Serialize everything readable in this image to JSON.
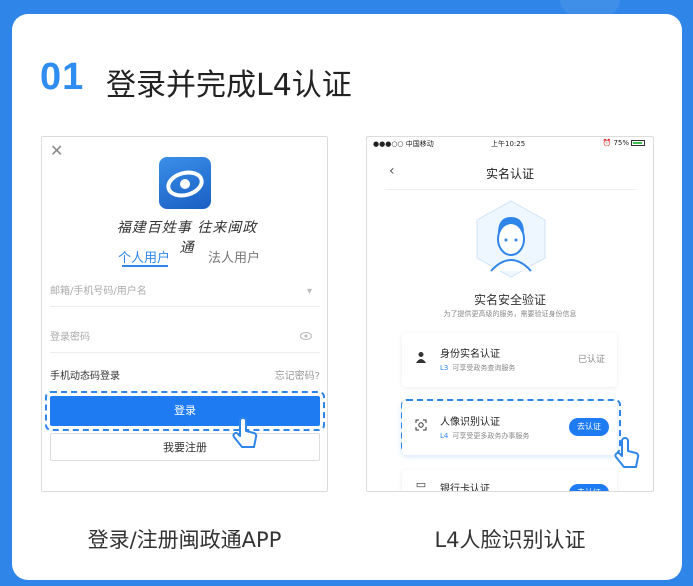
{
  "header": {
    "step_number": "01",
    "title": "登录并完成L4认证"
  },
  "left_phone": {
    "close": "✕",
    "slogan": "福建百姓事 往来闽政通",
    "tabs": [
      {
        "label": "个人用户",
        "active": true
      },
      {
        "label": "法人用户",
        "active": false
      }
    ],
    "username_placeholder": "邮箱/手机号码/用户名",
    "password_placeholder": "登录密码",
    "sms_login": "手机动态码登录",
    "forgot_password": "忘记密码?",
    "login_label": "登录",
    "register_label": "我要注册"
  },
  "right_phone": {
    "status": {
      "carrier": "●●●○○ 中国移动",
      "time": "上午10:25",
      "battery": "⏰ 75%"
    },
    "back": "‹",
    "nav_title": "实名认证",
    "verify_title": "实名安全验证",
    "verify_subtitle": "为了提供更高级的服务，需要验证身份信息",
    "items": [
      {
        "title": "身份实名认证",
        "level": "L3",
        "desc": "可享受政务查询服务",
        "status": "已认证"
      },
      {
        "title": "人像识别认证",
        "level": "L4",
        "desc": "可享受更多政务办事服务",
        "action": "去认证"
      },
      {
        "title": "银行卡认证",
        "action": "去认证"
      }
    ]
  },
  "captions": {
    "left": "登录/注册闽政通APP",
    "right": "L4人脸识别认证"
  },
  "colors": {
    "background": "#2f86e8",
    "accent": "#1f7bf2"
  }
}
